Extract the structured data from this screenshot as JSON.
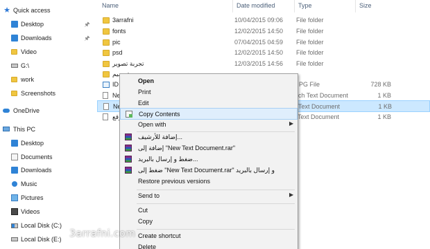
{
  "nav": {
    "quick_access": "Quick access",
    "quick_items": [
      {
        "label": "Desktop",
        "icon": "desktop-icon",
        "pinned": true
      },
      {
        "label": "Downloads",
        "icon": "downloads-icon",
        "pinned": true
      },
      {
        "label": "Video",
        "icon": "folder-icon"
      },
      {
        "label": "G:\\",
        "icon": "drive-icon"
      },
      {
        "label": "work",
        "icon": "folder-icon"
      },
      {
        "label": "Screenshots",
        "icon": "folder-icon"
      }
    ],
    "onedrive": "OneDrive",
    "this_pc": "This PC",
    "pc_items": [
      {
        "label": "Desktop",
        "icon": "desktop-icon"
      },
      {
        "label": "Documents",
        "icon": "documents-icon"
      },
      {
        "label": "Downloads",
        "icon": "downloads-icon"
      },
      {
        "label": "Music",
        "icon": "music-icon"
      },
      {
        "label": "Pictures",
        "icon": "pictures-icon"
      },
      {
        "label": "Videos",
        "icon": "videos-icon"
      },
      {
        "label": "Local Disk (C:)",
        "icon": "drive-icon"
      },
      {
        "label": "Local Disk (E:)",
        "icon": "drive-icon"
      }
    ]
  },
  "columns": {
    "name": "Name",
    "date": "Date modified",
    "type": "Type",
    "size": "Size"
  },
  "files": [
    {
      "name": "3arrafni",
      "date": "10/04/2015 09:06",
      "type": "File folder",
      "size": "",
      "kind": "folder"
    },
    {
      "name": "fonts",
      "date": "12/02/2015 14:50",
      "type": "File folder",
      "size": "",
      "kind": "folder"
    },
    {
      "name": "pic",
      "date": "07/04/2015 04:59",
      "type": "File folder",
      "size": "",
      "kind": "folder"
    },
    {
      "name": "psd",
      "date": "12/02/2015 14:50",
      "type": "File folder",
      "size": "",
      "kind": "folder"
    },
    {
      "name": "تجربة تصوير",
      "date": "12/03/2015 14:56",
      "type": "File folder",
      "size": "",
      "kind": "folder"
    },
    {
      "name": "تصميم",
      "date": "",
      "type": "",
      "size": "",
      "kind": "folder"
    },
    {
      "name": "ID",
      "date": "",
      "type": "PG File",
      "size": "728 KB",
      "kind": "image"
    },
    {
      "name": "Ne",
      "date": "",
      "type": "ich Text Document",
      "size": "1 KB",
      "kind": "text"
    },
    {
      "name": "Ne",
      "date": "",
      "type": "Text Document",
      "size": "1 KB",
      "kind": "text",
      "selected": true
    },
    {
      "name": "وقع",
      "date": "",
      "type": "Text Document",
      "size": "1 KB",
      "kind": "text"
    }
  ],
  "menu": {
    "items": [
      {
        "label": "Open",
        "bold": true
      },
      {
        "label": "Print"
      },
      {
        "label": "Edit"
      },
      {
        "label": "Copy Contents",
        "icon": "copy-contents-icon",
        "highlight": true
      },
      {
        "label": "Open with",
        "submenu": true
      },
      {
        "label": "إضافة للأرشيف...",
        "icon": "winrar-icon"
      },
      {
        "label": "إضافة إلى \"New Text Document.rar\"",
        "icon": "winrar-icon"
      },
      {
        "label": "ضغط و إرسال بالبريد...",
        "icon": "winrar-icon"
      },
      {
        "label": "ضغط إلى \"New Text Document.rar\" و إرسال بالبريد",
        "icon": "winrar-icon"
      },
      {
        "label": "Restore previous versions"
      },
      {
        "label": "Send to",
        "submenu": true
      },
      {
        "label": "Cut"
      },
      {
        "label": "Copy"
      },
      {
        "label": "Create shortcut"
      },
      {
        "label": "Delete"
      }
    ]
  },
  "watermark": "3arrafni.com",
  "colors": {
    "selection": "#cce8ff",
    "menu_bg": "#f2f2f2",
    "menu_highlight": "#dfeefc",
    "folder": "#f0c640",
    "header_text": "#4c607a"
  }
}
